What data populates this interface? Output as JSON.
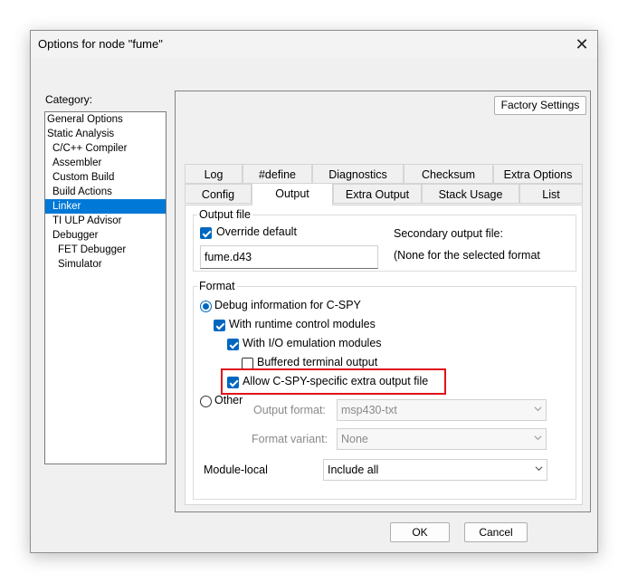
{
  "window": {
    "title": "Options for node \"fume\"",
    "close_icon": "close-icon"
  },
  "category": {
    "label": "Category:",
    "items": [
      {
        "label": "General Options"
      },
      {
        "label": "Static Analysis"
      },
      {
        "label": "C/C++ Compiler"
      },
      {
        "label": "Assembler"
      },
      {
        "label": "Custom Build"
      },
      {
        "label": "Build Actions"
      },
      {
        "label": "Linker"
      },
      {
        "label": "TI ULP Advisor"
      },
      {
        "label": "Debugger"
      },
      {
        "label": "FET Debugger"
      },
      {
        "label": "Simulator"
      }
    ],
    "selected": "Linker"
  },
  "factory_settings_label": "Factory Settings",
  "tabs_row1": [
    "Log",
    "#define",
    "Diagnostics",
    "Checksum",
    "Extra Options"
  ],
  "tabs_row2": [
    "Config",
    "Output",
    "Extra Output",
    "Stack Usage",
    "List"
  ],
  "active_tab": "Output",
  "output_file": {
    "legend": "Output file",
    "override_label": "Override default",
    "override_checked": true,
    "filename": "fume.d43",
    "secondary_label": "Secondary output file:",
    "secondary_value": "(None for the selected format"
  },
  "format": {
    "legend": "Format",
    "debug_label": "Debug information for C-SPY",
    "runtime_label": "With runtime control modules",
    "io_label": "With I/O emulation modules",
    "buffered_label": "Buffered terminal output",
    "allow_label": "Allow C-SPY-specific extra output file",
    "other_label": "Other",
    "output_format_label": "Output format:",
    "output_format_value": "msp430-txt",
    "format_variant_label": "Format variant:",
    "format_variant_value": "None",
    "module_local_label": "Module-local",
    "module_local_value": "Include all"
  },
  "buttons": {
    "ok": "OK",
    "cancel": "Cancel"
  },
  "colors": {
    "accent": "#0067c0",
    "selection": "#0078d7",
    "highlight": "#e0111b"
  }
}
